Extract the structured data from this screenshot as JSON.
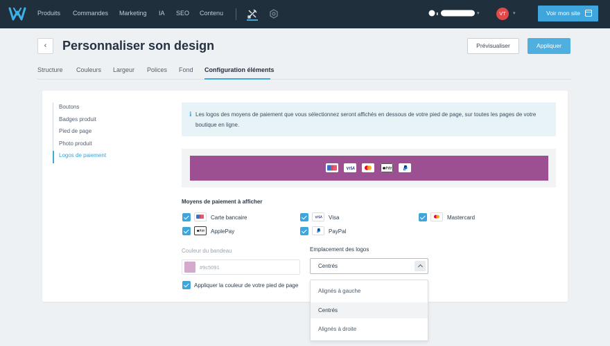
{
  "nav": {
    "items": [
      "Produits",
      "Commandes",
      "Marketing",
      "IA",
      "SEO",
      "Contenu"
    ],
    "user_initials": "VT",
    "view_site_label": "Voir mon site"
  },
  "header": {
    "title": "Personnaliser son design",
    "preview_label": "Prévisualiser",
    "apply_label": "Appliquer"
  },
  "tabs": [
    "Structure",
    "Couleurs",
    "Largeur",
    "Polices",
    "Fond",
    "Configuration éléments"
  ],
  "sidebar": {
    "items": [
      "Boutons",
      "Badges produit",
      "Pied de page",
      "Photo produit",
      "Logos de paiement"
    ]
  },
  "info": {
    "text": "Les logos des moyens de paiement que vous sélectionnez seront affichés en dessous de votre pied de page, sur toutes les pages de votre boutique en ligne."
  },
  "payment": {
    "section_label": "Moyens de paiement à afficher",
    "methods": [
      {
        "label": "Carte bancaire",
        "checked": true
      },
      {
        "label": "Visa",
        "checked": true
      },
      {
        "label": "Mastercard",
        "checked": true
      },
      {
        "label": "ApplePay",
        "checked": true
      },
      {
        "label": "PayPal",
        "checked": true
      }
    ]
  },
  "banner_color": {
    "label": "Couleur du bandeau",
    "value": "#9c5091"
  },
  "logo_position": {
    "label": "Emplacement des logos",
    "selected": "Centrés",
    "options": [
      "Alignés à gauche",
      "Centrés",
      "Alignés à droite"
    ]
  },
  "footer_color_option": {
    "label": "Appliquer la couleur de votre pied de page",
    "checked": true
  },
  "colors": {
    "nav_bg": "#1f2f3c",
    "accent": "#3ea6dd",
    "banner": "#9c5091"
  }
}
